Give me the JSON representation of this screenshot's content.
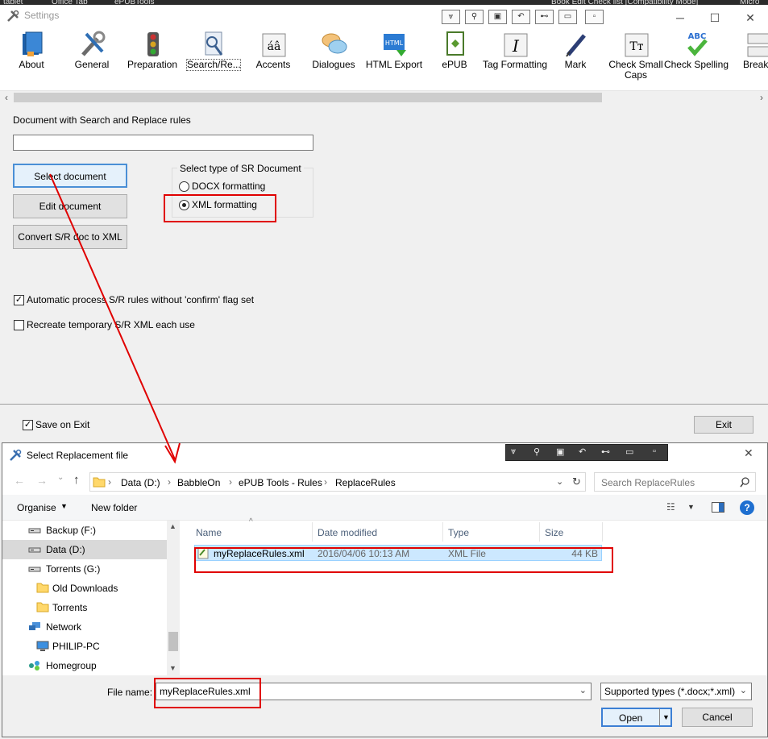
{
  "background_strip": {
    "left": "tablet",
    "mid1": "Office Tab",
    "mid2": "ePUBTools",
    "right1": "Book Edit Check list [Compatibility Mode]",
    "right2": "Micro"
  },
  "settings": {
    "title": "Settings",
    "ribbon": [
      {
        "label": "About",
        "icon": "book-icon"
      },
      {
        "label": "General",
        "icon": "tools-icon"
      },
      {
        "label": "Preparation",
        "icon": "traffic-light-icon"
      },
      {
        "label": "Search/Re...",
        "icon": "search-replace-icon"
      },
      {
        "label": "Accents",
        "icon": "accents-icon"
      },
      {
        "label": "Dialogues",
        "icon": "speech-bubbles-icon"
      },
      {
        "label": "HTML Export",
        "icon": "html-icon"
      },
      {
        "label": "ePUB",
        "icon": "epub-icon"
      },
      {
        "label": "Tag Formatting",
        "icon": "italic-icon"
      },
      {
        "label": "Mark",
        "icon": "pen-icon"
      },
      {
        "label": "Check Small Caps",
        "icon": "small-caps-icon"
      },
      {
        "label": "Check Spelling",
        "icon": "spellcheck-icon"
      },
      {
        "label": "Breaks",
        "icon": "breaks-icon"
      }
    ],
    "doc_label": "Document with Search and Replace rules",
    "doc_value": "",
    "select_document": "Select document",
    "edit_document": "Edit document",
    "convert": "Convert S/R doc to XML",
    "group_title": "Select type of SR Document",
    "radio_docx": "DOCX formatting",
    "radio_xml": "XML formatting",
    "auto_process": "Automatic process S/R rules without 'confirm' flag set",
    "recreate_xml": "Recreate temporary S/R XML each use",
    "save_on_exit": "Save on Exit",
    "exit": "Exit"
  },
  "dialog": {
    "title": "Select Replacement file",
    "breadcrumb": [
      "Data (D:)",
      "BabbleOn",
      "ePUB Tools - Rules",
      "ReplaceRules"
    ],
    "search_placeholder": "Search ReplaceRules",
    "organise": "Organise",
    "new_folder": "New folder",
    "nav_items": [
      {
        "label": "Backup (F:)",
        "icon": "drive-icon"
      },
      {
        "label": "Data (D:)",
        "icon": "drive-icon"
      },
      {
        "label": "Torrents (G:)",
        "icon": "drive-icon"
      },
      {
        "label": "Old Downloads",
        "icon": "folder-icon"
      },
      {
        "label": "Torrents",
        "icon": "folder-icon"
      },
      {
        "label": "Network",
        "icon": "network-icon"
      },
      {
        "label": "PHILIP-PC",
        "icon": "computer-icon"
      },
      {
        "label": "Homegroup",
        "icon": "homegroup-icon"
      }
    ],
    "columns": {
      "name": "Name",
      "date": "Date modified",
      "type": "Type",
      "size": "Size"
    },
    "files": [
      {
        "name": "myReplaceRules.xml",
        "date": "2016/04/06 10:13 AM",
        "type": "XML File",
        "size": "44 KB"
      }
    ],
    "file_name_label": "File name:",
    "file_name_value": "myReplaceRules.xml",
    "filter": "Supported types (*.docx;*.xml)",
    "open": "Open",
    "cancel": "Cancel"
  },
  "colors": {
    "highlight_red": "#e00000",
    "selected_row": "#cce8ff",
    "help_blue": "#1e6fd0"
  }
}
